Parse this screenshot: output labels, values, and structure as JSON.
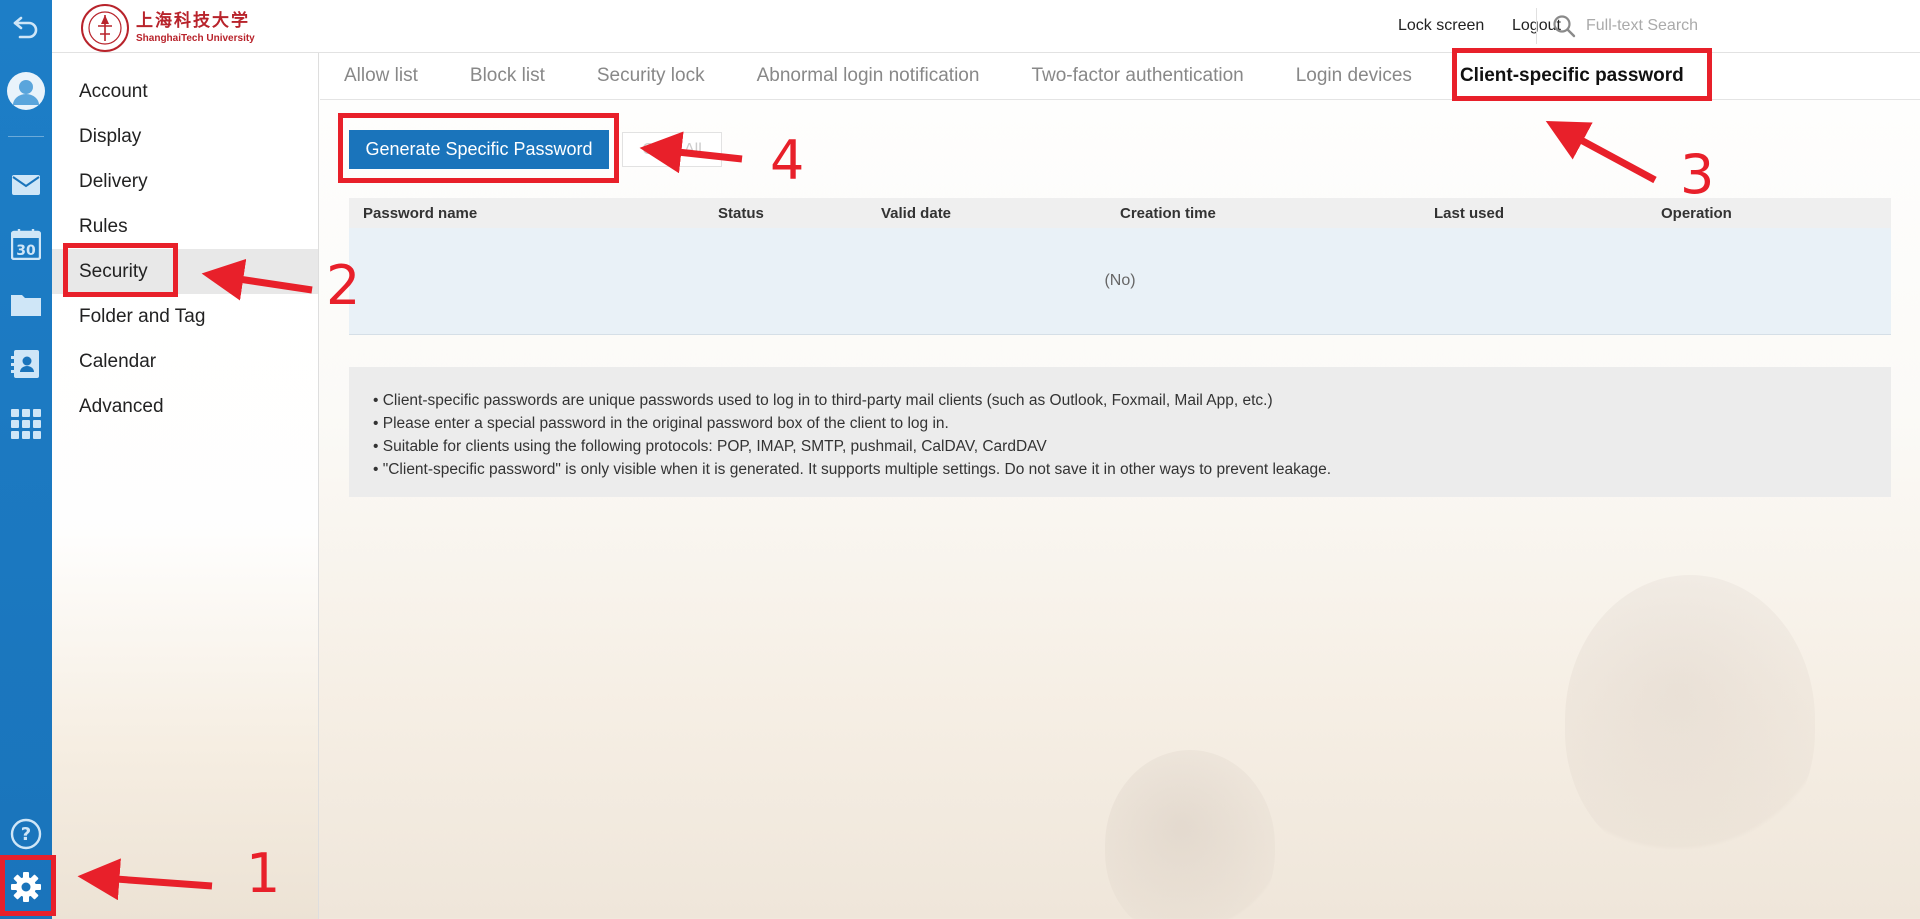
{
  "app": {
    "logo_cn": "上海科技大学",
    "logo_en": "ShanghaiTech University"
  },
  "rail": {
    "icons": [
      "back-icon",
      "avatar-icon",
      "mail-icon",
      "calendar-icon",
      "folder-icon",
      "contacts-icon",
      "apps-icon",
      "help-icon",
      "gear-icon"
    ],
    "calendar_day": "30",
    "help_glyph": "?"
  },
  "header": {
    "lock_screen": "Lock screen",
    "logout": "Logout",
    "search_placeholder": "Full-text Search"
  },
  "nav": {
    "items": [
      "Account",
      "Display",
      "Delivery",
      "Rules",
      "Security",
      "Folder and Tag",
      "Calendar",
      "Advanced"
    ],
    "active": "Security"
  },
  "tabs": {
    "items": [
      "Allow list",
      "Block list",
      "Security lock",
      "Abnormal login notification",
      "Two-factor authentication",
      "Login devices",
      "Client-specific password"
    ],
    "active": "Client-specific password"
  },
  "actions": {
    "generate": "Generate Specific Password",
    "clear_all": "Clear All"
  },
  "table": {
    "columns": [
      "Password name",
      "Status",
      "Valid date",
      "Creation time",
      "Last used",
      "Operation"
    ],
    "empty_text": "(No)"
  },
  "info": {
    "lines": [
      "• Client-specific passwords are unique passwords used to log in to third-party mail clients (such as Outlook, Foxmail, Mail App, etc.)",
      "• Please enter a special password in the original password box of the client to log in.",
      "• Suitable for clients using the following protocols: POP, IMAP, SMTP, pushmail, CalDAV, CardDAV",
      "• \"Client-specific password\" is only visible when it is generated. It supports multiple settings. Do not save it in other ways to prevent leakage."
    ]
  },
  "annotations": {
    "numbers": [
      "1",
      "2",
      "3",
      "4"
    ],
    "color": "#e8202a"
  },
  "colors": {
    "primary": "#1a74bb",
    "logo_red": "#b8232b"
  }
}
